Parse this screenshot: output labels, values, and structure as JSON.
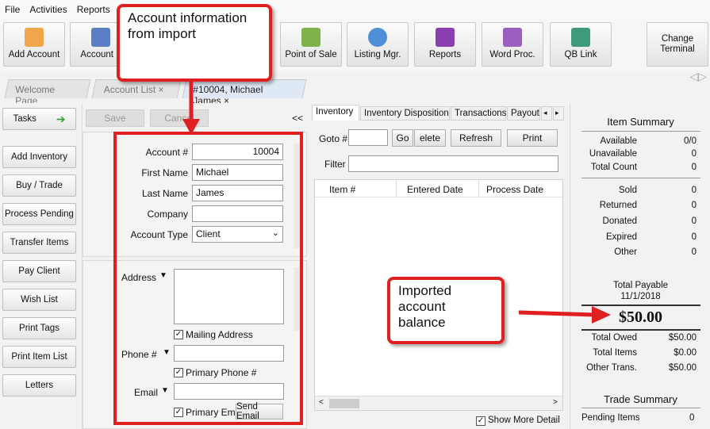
{
  "menu": [
    "File",
    "Activities",
    "Reports"
  ],
  "toolbar": {
    "buttons": [
      {
        "label": "Add Account",
        "icon": "add-account-icon"
      },
      {
        "label": "Account L",
        "icon": "account-list-icon"
      },
      {
        "label": "Point of Sale",
        "icon": "point-of-sale-icon"
      },
      {
        "label": "Listing Mgr.",
        "icon": "listing-manager-icon"
      },
      {
        "label": "Reports",
        "icon": "reports-icon"
      },
      {
        "label": "Word Proc.",
        "icon": "word-processor-icon"
      },
      {
        "label": "QB Link",
        "icon": "qb-link-icon"
      }
    ],
    "change_terminal": "Change\nTerminal"
  },
  "tabs": [
    {
      "label": "Welcome Page"
    },
    {
      "label": "Account List ×"
    },
    {
      "label": "#10004, Michael James ×"
    }
  ],
  "left": {
    "tasks": "Tasks",
    "buttons": [
      "Add Inventory",
      "Buy / Trade",
      "Process Pending",
      "Transfer Items",
      "Pay Client",
      "Wish List",
      "Print Tags",
      "Print Item List",
      "Letters"
    ]
  },
  "form": {
    "save": "Save",
    "cancel": "Cancel",
    "collapse": "<<",
    "account_num_label": "Account #",
    "account_num": "10004",
    "first_name_label": "First Name",
    "first_name": "Michael",
    "last_name_label": "Last Name",
    "last_name": "James",
    "company_label": "Company",
    "company": "",
    "account_type_label": "Account Type",
    "account_type": "Client",
    "address_label": "Address",
    "mailing_address": "Mailing Address",
    "phone_label": "Phone #",
    "primary_phone": "Primary Phone #",
    "email_label": "Email",
    "primary_email": "Primary Email",
    "send_email": "Send Email"
  },
  "inventory": {
    "tabs": [
      "Inventory",
      "Inventory Disposition",
      "Transactions",
      "Payouts"
    ],
    "goto_label": "Goto #",
    "go": "Go",
    "delete": "elete",
    "refresh": "Refresh",
    "print": "Print",
    "filter_label": "Filter",
    "columns": [
      "Item #",
      "Entered Date",
      "Process Date"
    ],
    "show_more": "Show More Detail"
  },
  "summary": {
    "item_summary_title": "Item Summary",
    "item_rows": [
      {
        "k": "Available",
        "v": "0/0"
      },
      {
        "k": "Unavailable",
        "v": "0"
      },
      {
        "k": "Total Count",
        "v": "0"
      }
    ],
    "status_rows": [
      {
        "k": "Sold",
        "v": "0"
      },
      {
        "k": "Returned",
        "v": "0"
      },
      {
        "k": "Donated",
        "v": "0"
      },
      {
        "k": "Expired",
        "v": "0"
      },
      {
        "k": "Other",
        "v": "0"
      }
    ],
    "total_payable_label": "Total Payable",
    "total_payable_date": "11/1/2018",
    "total_payable": "$50.00",
    "money_rows": [
      {
        "k": "Total Owed",
        "v": "$50.00"
      },
      {
        "k": "Total Items",
        "v": "$0.00"
      },
      {
        "k": "Other Trans.",
        "v": "$50.00"
      }
    ],
    "trade_summary_title": "Trade Summary",
    "pending_items_label": "Pending Items",
    "pending_items": "0"
  },
  "annotations": {
    "account_info": "Account information\nfrom import",
    "imported_balance": "Imported\naccount\nbalance"
  },
  "colors": {
    "annotation_red": "#e02020",
    "active_tab": "#dfe9f5"
  }
}
